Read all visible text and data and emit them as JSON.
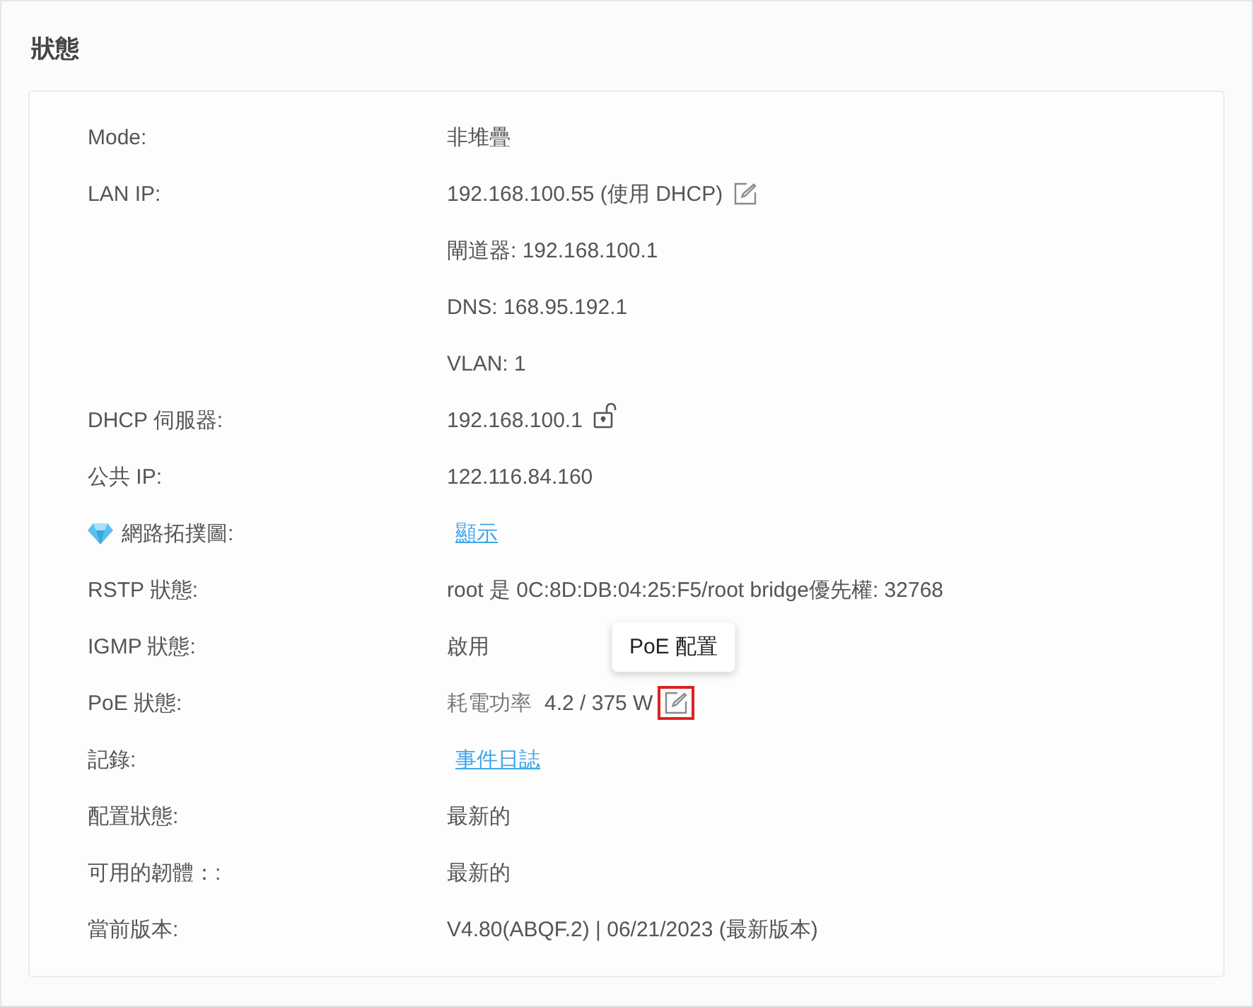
{
  "section_title": "狀態",
  "rows": [
    {
      "kind": "plain",
      "label": "Mode:",
      "parts": [
        {
          "kind": "text",
          "text": "非堆疊"
        }
      ]
    },
    {
      "kind": "plain",
      "label": "LAN IP:",
      "parts": [
        {
          "kind": "text",
          "text": "192.168.100.55 (使用 DHCP)"
        },
        {
          "kind": "edit",
          "highlighted": false
        }
      ]
    },
    {
      "kind": "plain",
      "parts": [
        {
          "kind": "text",
          "text": "閘道器: 192.168.100.1"
        }
      ]
    },
    {
      "kind": "plain",
      "parts": [
        {
          "kind": "text",
          "text": "DNS: 168.95.192.1"
        }
      ]
    },
    {
      "kind": "plain",
      "parts": [
        {
          "kind": "text",
          "text": "VLAN: 1"
        }
      ]
    },
    {
      "kind": "plain",
      "label": "DHCP 伺服器:",
      "parts": [
        {
          "kind": "text",
          "text": "192.168.100.1"
        },
        {
          "kind": "lock"
        }
      ]
    },
    {
      "kind": "plain",
      "label": "公共 IP:",
      "parts": [
        {
          "kind": "text",
          "text": "122.116.84.160"
        }
      ]
    },
    {
      "kind": "premium",
      "label": "網路拓撲圖:",
      "parts": [
        {
          "kind": "link",
          "text": "顯示"
        }
      ]
    },
    {
      "kind": "plain",
      "label": "RSTP 狀態:",
      "parts": [
        {
          "kind": "text",
          "text": "root 是 0C:8D:DB:04:25:F5/root bridge優先權: 32768"
        }
      ]
    },
    {
      "kind": "plain",
      "label": "IGMP 狀態:",
      "parts": [
        {
          "kind": "text",
          "text": "啟用"
        }
      ]
    },
    {
      "kind": "plain",
      "label": "PoE 狀態:",
      "parts": [
        {
          "kind": "caption",
          "text": "耗電功率"
        },
        {
          "kind": "text",
          "text": "4.2 / 375 W"
        },
        {
          "kind": "edit",
          "highlighted": true,
          "tooltip": "PoE 配置"
        }
      ]
    },
    {
      "kind": "plain",
      "label": "記錄:",
      "parts": [
        {
          "kind": "link",
          "text": "事件日誌"
        }
      ]
    },
    {
      "kind": "plain",
      "label": "配置狀態:",
      "parts": [
        {
          "kind": "text",
          "text": "最新的"
        }
      ]
    },
    {
      "kind": "plain",
      "label": "可用的韌體：:",
      "parts": [
        {
          "kind": "text",
          "text": "最新的"
        }
      ]
    },
    {
      "kind": "plain",
      "label": "當前版本:",
      "parts": [
        {
          "kind": "text",
          "text": "V4.80(ABQF.2) | 06/21/2023 (最新版本)"
        }
      ]
    }
  ]
}
